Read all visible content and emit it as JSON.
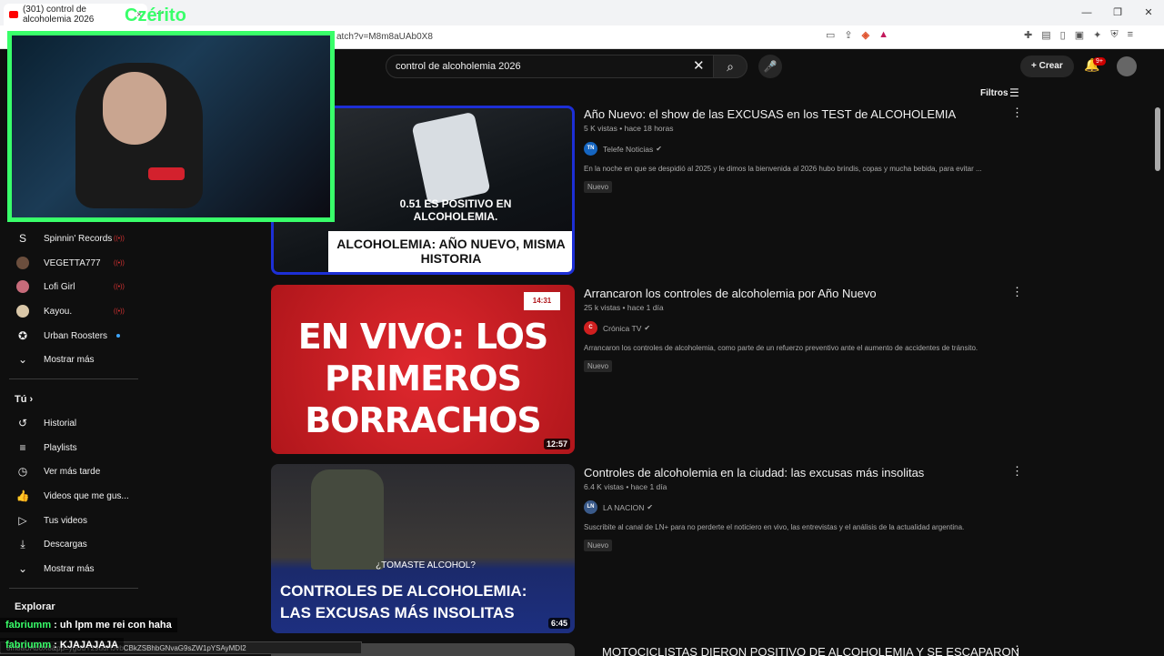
{
  "browser": {
    "tab_title": "(301) control de alcoholemia 2026",
    "tab_close": "×",
    "new_tab": "+",
    "url": "atch?v=M8m8aUAb0X8",
    "status_url": "8m8aUAb0X8&pp=ygUbY29udHJvbCBkZSBhbGNvaG9sZW1pYSAyMDI2",
    "window_controls": [
      "—",
      "❐",
      "✕"
    ]
  },
  "overlay": {
    "webcam_tag": "Czérito",
    "chat": [
      {
        "user": "fabriumm",
        "sep": " : ",
        "text": "uh lpm me rei con haha"
      },
      {
        "user": "fabriumm",
        "sep": " : ",
        "text": "KJAJAJAJA"
      }
    ]
  },
  "header": {
    "search_value": "control de alcoholemia 2026",
    "clear": "✕",
    "search_icon": "⌕",
    "mic_icon": "🎤",
    "create_label": "Crear",
    "create_plus": "+",
    "notif_badge": "9+",
    "filters_label": "Filtros"
  },
  "sidebar": {
    "subscriptions": [
      {
        "label": "Spinnin' Records",
        "color": "#ffffff",
        "status": "live"
      },
      {
        "label": "VEGETTA777",
        "color": "#6b4e3d",
        "status": "live"
      },
      {
        "label": "Lofi Girl",
        "color": "#c76b7a",
        "status": "live"
      },
      {
        "label": "Kayou.",
        "color": "#d9c7a8",
        "status": "live"
      },
      {
        "label": "Urban Roosters",
        "color": "#333333",
        "status": "new"
      }
    ],
    "show_more_1": "Mostrar más",
    "you_title": "Tú",
    "you_chevron": "›",
    "you_items": [
      {
        "label": "Historial",
        "icon": "↺"
      },
      {
        "label": "Playlists",
        "icon": "≡"
      },
      {
        "label": "Ver más tarde",
        "icon": "◷"
      },
      {
        "label": "Videos que me gus...",
        "icon": "👍"
      },
      {
        "label": "Tus videos",
        "icon": "▷"
      },
      {
        "label": "Descargas",
        "icon": "⤓"
      }
    ],
    "show_more_2": "Mostrar más",
    "explore_title": "Explorar",
    "chevron_down": "⌄"
  },
  "results": [
    {
      "title": "Año Nuevo: el show de las EXCUSAS en los TEST de ALCOHOLEMIA",
      "views": "5 K vistas",
      "age": "hace 18 horas",
      "channel": "Telefe Noticias",
      "channel_abbr": "TN",
      "channel_color": "#1565c0",
      "desc": "En la noche en que se despidió al 2025 y le dimos la bienvenida al 2026 hubo brindis, copas y mucha bebida, para evitar ...",
      "badge": "Nuevo",
      "duration": "",
      "thumb_text_1": "0.51 ES POSITIVO EN ALCOHOLEMIA.",
      "thumb_text_2": "ALCOHOLEMIA: AÑO NUEVO, MISMA HISTORIA"
    },
    {
      "title": "Arrancaron los controles de alcoholemia por Año Nuevo",
      "views": "25 k vistas",
      "age": "hace 1 día",
      "channel": "Crónica TV",
      "channel_abbr": "C",
      "channel_color": "#d01f1f",
      "desc": "Arrancaron los controles de alcoholemia, como parte de un refuerzo preventivo ante el aumento de accidentes de tránsito.",
      "badge": "Nuevo",
      "duration": "12:57",
      "thumb_text_1": "EN VIVO: LOS PRIMEROS BORRACHOS",
      "thumb_text_2": "14:31"
    },
    {
      "title": "Controles de alcoholemia en la ciudad: las excusas más insolitas",
      "views": "6.4 K vistas",
      "age": "hace 1 día",
      "channel": "LA NACION",
      "channel_abbr": "LN",
      "channel_color": "#3a5a8a",
      "desc": "Suscribite al canal de LN+ para no perderte el noticiero en vivo, las entrevistas y el análisis de la actualidad argentina.",
      "badge": "Nuevo",
      "duration": "6:45",
      "thumb_text_1": "¿TOMASTE ALCOHOL?",
      "thumb_text_2": "CONTROLES DE ALCOHOLEMIA: LAS EXCUSAS MÁS INSOLITAS"
    },
    {
      "title": "MOTOCICLISTAS DIERON POSITIVO DE ALCOHOLEMIA Y SE ESCAPARON",
      "views": "",
      "age": "",
      "channel": "",
      "channel_abbr": "",
      "channel_color": "#d01f1f",
      "desc": "",
      "badge": "",
      "duration": "",
      "thumb_text_1": "",
      "thumb_text_2": ""
    }
  ],
  "meta_sep": "•",
  "verified": "✔",
  "more_icon": "⋮"
}
